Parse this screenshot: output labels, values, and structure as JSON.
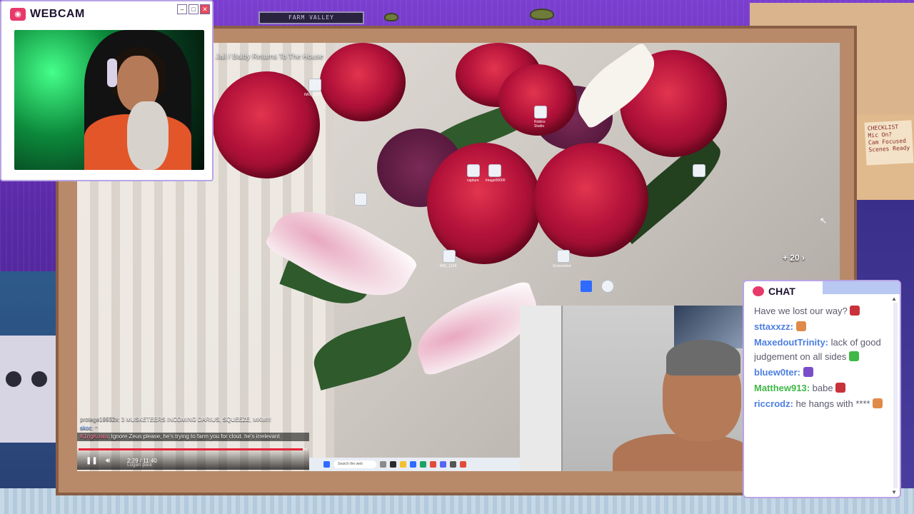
{
  "webcam": {
    "title": "WEBCAM",
    "minimize": "–",
    "maximize": "□",
    "close": "✕"
  },
  "scene": {
    "top_sign": "FARM VALLEY",
    "note_text": "CHECKLIST\nMic On?\nCam Focused\nScenes Ready"
  },
  "stream": {
    "title": "Jail / Baldy Returns To The House",
    "more_count": "+ 20",
    "time_display": "2:29 / 11:40",
    "progress_fraction": 0.98,
    "caption_hint": "Logan paul",
    "taskbar_search": "Search the web",
    "desktop_icons": [
      {
        "label": "IMG_9118"
      },
      {
        "label": "Roblox Studio"
      },
      {
        "label": "capture"
      },
      {
        "label": "image00000"
      },
      {
        "label": "IMG_1234"
      },
      {
        "label": "Screenshot"
      }
    ],
    "inner_chat": [
      {
        "user": "protege19932x",
        "text": ": 3 MUSKETEERS INCOMING DARIUS, SQUEEZE, MKM!!!",
        "style": "plain"
      },
      {
        "user": "skoc",
        "text": ": ^",
        "style": "blue"
      },
      {
        "user": "K1ngKoala",
        "text": ": Ignore Zeus please, he's trying to farm you for clout. he's irrelevant",
        "style": "red"
      }
    ]
  },
  "chat": {
    "title": "CHAT",
    "messages": [
      {
        "user": "",
        "text": "Have we lost our way?",
        "user_color": "#5a7fd8"
      },
      {
        "user": "sttaxxzz:",
        "text": "",
        "user_color": "#4d7fe0"
      },
      {
        "user": "MaxedoutTrinity:",
        "text": "lack of good judgement on all sides",
        "user_color": "#4d7fe0"
      },
      {
        "user": "bluew0ter:",
        "text": "",
        "user_color": "#4d7fe0"
      },
      {
        "user": "Matthew913:",
        "text": "babe",
        "user_color": "#3fb846"
      },
      {
        "user": "riccrodz:",
        "text": "he hangs with ****",
        "user_color": "#4d7fe0"
      }
    ],
    "scroll_up": "▲",
    "scroll_down": "▼"
  }
}
